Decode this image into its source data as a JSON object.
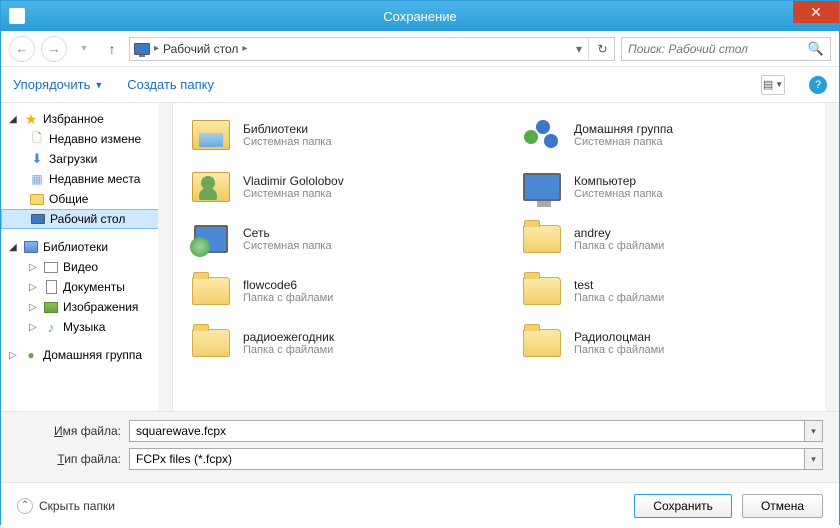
{
  "window": {
    "title": "Сохранение"
  },
  "nav": {
    "breadcrumb_label": "Рабочий стол",
    "search_placeholder": "Поиск: Рабочий стол"
  },
  "toolbar": {
    "organize": "Упорядочить",
    "new_folder": "Создать папку"
  },
  "tree": {
    "favorites": "Избранное",
    "fav_items": [
      {
        "label": "Недавно измене"
      },
      {
        "label": "Загрузки"
      },
      {
        "label": "Недавние места"
      },
      {
        "label": "Общие"
      },
      {
        "label": "Рабочий стол",
        "selected": true
      }
    ],
    "libraries": "Библиотеки",
    "lib_items": [
      {
        "label": "Видео"
      },
      {
        "label": "Документы"
      },
      {
        "label": "Изображения"
      },
      {
        "label": "Музыка"
      }
    ],
    "homegroup": "Домашняя группа"
  },
  "items": [
    {
      "name": "Библиотеки",
      "sub": "Системная папка",
      "icon": "libraries"
    },
    {
      "name": "Домашняя группа",
      "sub": "Системная папка",
      "icon": "homegroup"
    },
    {
      "name": "Vladimir Gololobov",
      "sub": "Системная папка",
      "icon": "user"
    },
    {
      "name": "Компьютер",
      "sub": "Системная папка",
      "icon": "computer"
    },
    {
      "name": "Сеть",
      "sub": "Системная папка",
      "icon": "network"
    },
    {
      "name": "andrey",
      "sub": "Папка с файлами",
      "icon": "folder"
    },
    {
      "name": "flowcode6",
      "sub": "Папка с файлами",
      "icon": "folder"
    },
    {
      "name": "test",
      "sub": "Папка с файлами",
      "icon": "folder"
    },
    {
      "name": "радиоежегодник",
      "sub": "Папка с файлами",
      "icon": "folder"
    },
    {
      "name": "Радиолоцман",
      "sub": "Папка с файлами",
      "icon": "folder"
    }
  ],
  "fields": {
    "filename_label_pre": "",
    "filename_label_u": "И",
    "filename_label_post": "мя файла:",
    "filename_value": "squarewave.fcpx",
    "filetype_label_pre": "",
    "filetype_label_u": "Т",
    "filetype_label_post": "ип файла:",
    "filetype_value": "FCPx files (*.fcpx)"
  },
  "footer": {
    "hide_folders": "Скрыть папки",
    "save": "Сохранить",
    "cancel": "Отмена"
  }
}
